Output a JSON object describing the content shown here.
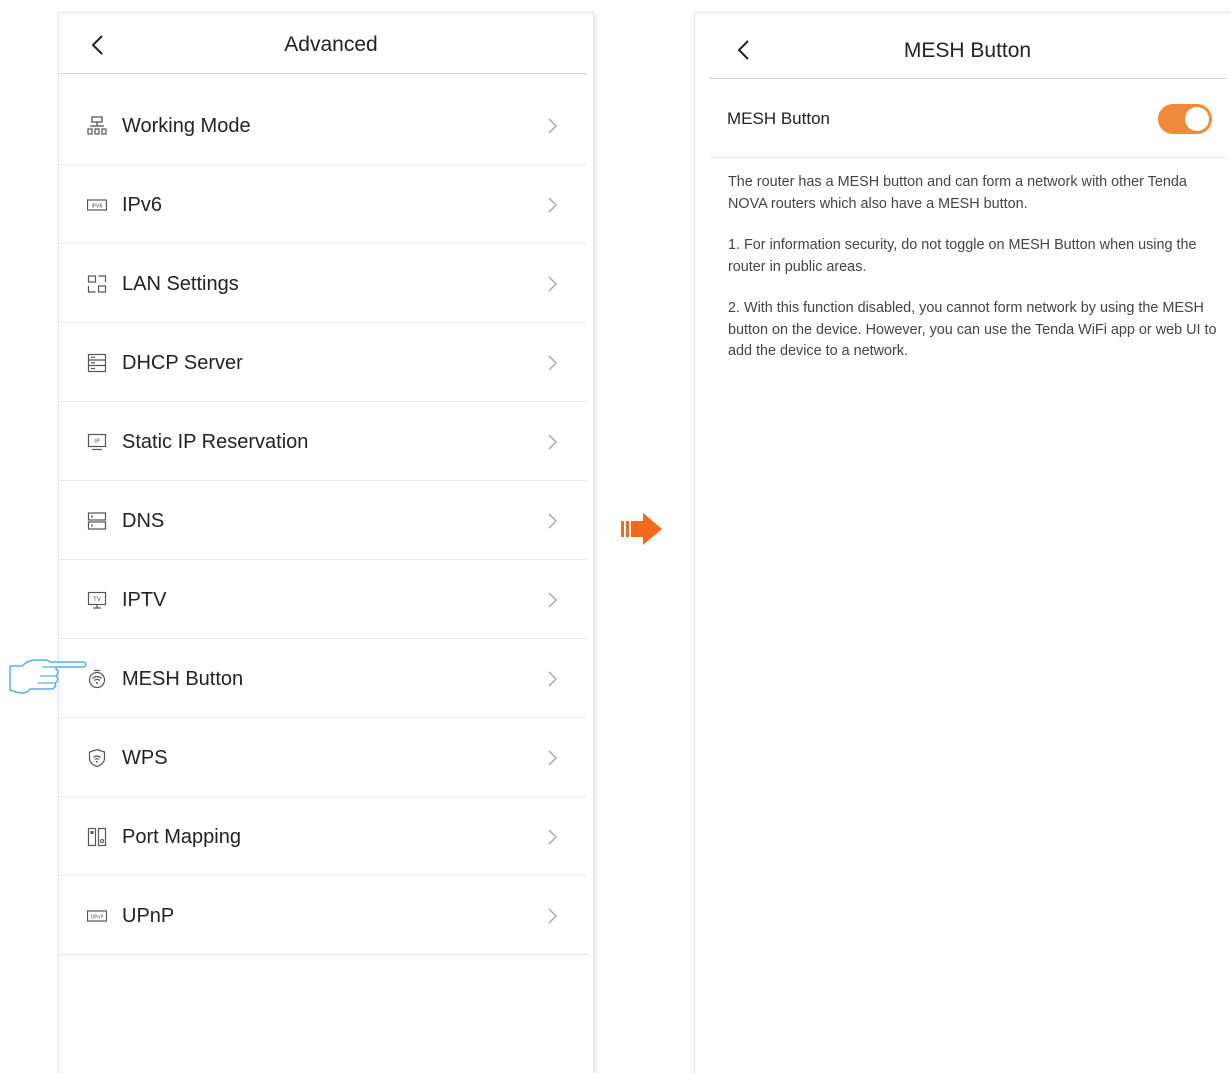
{
  "left": {
    "title": "Advanced",
    "items": [
      {
        "label": "Working Mode",
        "icon": "working-mode-icon"
      },
      {
        "label": "IPv6",
        "icon": "ipv6-icon"
      },
      {
        "label": "LAN Settings",
        "icon": "lan-settings-icon"
      },
      {
        "label": "DHCP Server",
        "icon": "dhcp-server-icon"
      },
      {
        "label": "Static IP Reservation",
        "icon": "static-ip-icon"
      },
      {
        "label": "DNS",
        "icon": "dns-icon"
      },
      {
        "label": "IPTV",
        "icon": "iptv-icon"
      },
      {
        "label": "MESH Button",
        "icon": "mesh-icon"
      },
      {
        "label": "WPS",
        "icon": "wps-icon"
      },
      {
        "label": "Port Mapping",
        "icon": "port-mapping-icon"
      },
      {
        "label": "UPnP",
        "icon": "upnp-icon"
      }
    ]
  },
  "right": {
    "title": "MESH Button",
    "toggle_label": "MESH Button",
    "toggle_on": true,
    "description": [
      "The router has a MESH button and can form a network with other Tenda NOVA routers which also have a MESH button.",
      "1. For information security, do not toggle on MESH Button when using the router in public areas.",
      "2. With this function disabled, you cannot form network by using the MESH button on the device. However, you can use the Tenda WiFi app or web UI to add the device to a network."
    ]
  },
  "colors": {
    "accent": "#f08a37",
    "arrow": "#f26b1d",
    "hand": "#4fb3e8"
  }
}
